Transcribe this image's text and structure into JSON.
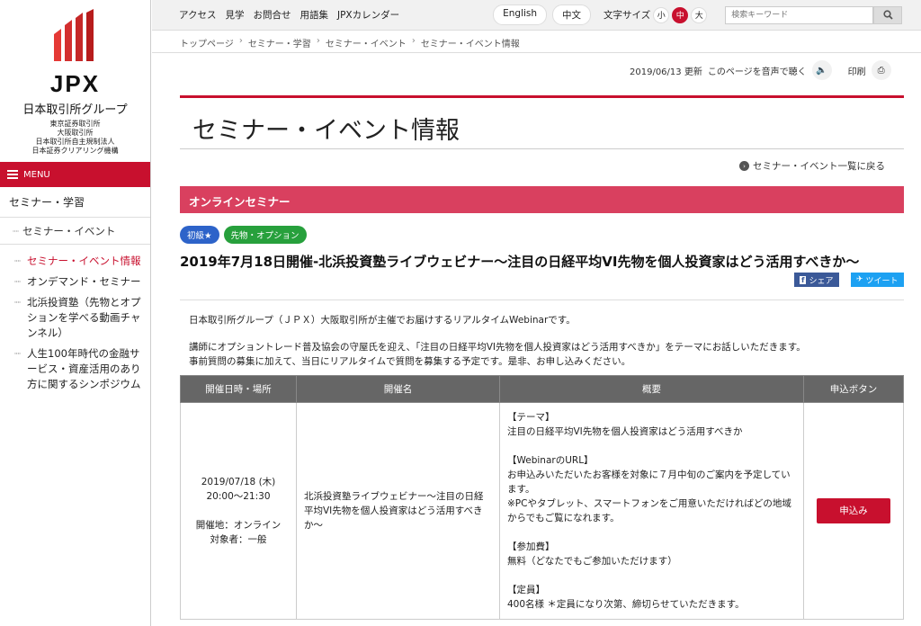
{
  "brand": {
    "logo_text": "JPX",
    "group": "日本取引所グループ",
    "subsidiaries": [
      "東京証券取引所",
      "大阪取引所",
      "日本取引所自主規制法人",
      "日本証券クリアリング機構"
    ]
  },
  "sidebar": {
    "menu_label": "MENU",
    "section": "セミナー・学習",
    "subsection": "セミナー・イベント",
    "items": [
      {
        "label": "セミナー・イベント情報",
        "active": true
      },
      {
        "label": "オンデマンド・セミナー",
        "active": false
      },
      {
        "label": "北浜投資塾（先物とオプションを学べる動画チャンネル）",
        "active": false
      },
      {
        "label": "人生100年時代の金融サービス・資産活用のあり方に関するシンポジウム",
        "active": false
      }
    ]
  },
  "topnav": {
    "links": [
      "アクセス",
      "見学",
      "お問合せ",
      "用語集",
      "JPXカレンダー"
    ],
    "lang": [
      "English",
      "中文"
    ],
    "fontsize_label": "文字サイズ",
    "fontsizes": [
      "小",
      "中",
      "大"
    ],
    "search_placeholder": "検索キーワード"
  },
  "breadcrumb": [
    "トップページ",
    "セミナー・学習",
    "セミナー・イベント",
    "セミナー・イベント情報"
  ],
  "page_meta": {
    "updated": "2019/06/13 更新",
    "read_aloud": "このページを音声で聴く",
    "print": "印刷"
  },
  "page_title": "セミナー・イベント情報",
  "back_link": "セミナー・イベント一覧に戻る",
  "section_title": "オンラインセミナー",
  "tags": [
    "初級★",
    "先物・オプション"
  ],
  "event_title": "2019年7月18日開催-北浜投資塾ライブウェビナー～注目の日経平均VI先物を個人投資家はどう活用すべきか～",
  "share": {
    "facebook": "シェア",
    "twitter": "ツイート"
  },
  "intro": {
    "line1": "日本取引所グループ（ＪＰＸ）大阪取引所が主催でお届けするリアルタイムWebinarです。",
    "line2": "講師にオプショントレード普及協会の守屋氏を迎え、「注目の日経平均VI先物を個人投資家はどう活用すべきか」をテーマにお話しいただきます。",
    "line3": "事前質問の募集に加えて、当日にリアルタイムで質問を募集する予定です。是非、お申し込みください。"
  },
  "table": {
    "headers": [
      "開催日時・場所",
      "開催名",
      "概要",
      "申込ボタン"
    ],
    "row": {
      "date": "2019/07/18 (木)",
      "time": "20:00～21:30",
      "venue": "開催地：オンライン",
      "audience": "対象者：一般",
      "name": "北浜投資塾ライブウェビナー～注目の日経平均VI先物を個人投資家はどう活用すべきか～",
      "theme_h": "【テーマ】",
      "theme": "注目の日経平均VI先物を個人投資家はどう活用すべきか",
      "url_h": "【WebinarのURL】",
      "url_1": "お申込みいただいたお客様を対象に７月中旬のご案内を予定しています。",
      "url_2": "※PCやタブレット、スマートフォンをご用意いただければどの地域からでもご覧になれます。",
      "fee_h": "【参加費】",
      "fee": "無料（どなたでもご参加いただけます）",
      "cap_h": "【定員】",
      "cap": "400名様 ＊定員になり次第、締切らせていただきます。",
      "apply": "申込み"
    }
  },
  "colors": {
    "brand_red": "#c8102e",
    "section_pink": "#d9405f",
    "tag_blue": "#2d63c9",
    "tag_green": "#27a03c"
  }
}
